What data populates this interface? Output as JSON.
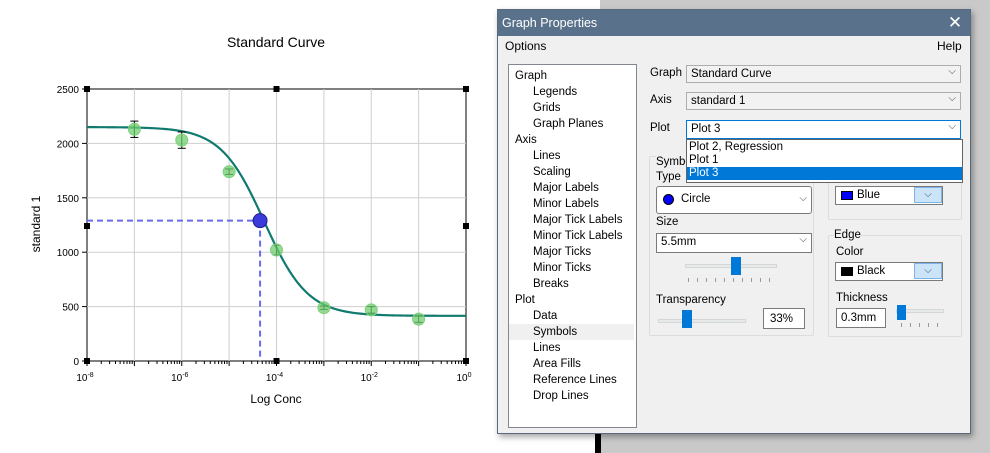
{
  "chart": {
    "title": "Standard Curve",
    "xlabel": "Log Conc",
    "ylabel": "standard 1"
  },
  "chart_data": {
    "type": "scatter",
    "title": "Standard Curve",
    "xlabel": "Log Conc",
    "ylabel": "standard 1",
    "x_scale": "log",
    "xlim": [
      1e-08,
      1
    ],
    "ylim": [
      0,
      2500
    ],
    "x_tick_labels": [
      {
        "base": "10",
        "exp": "-8"
      },
      {
        "base": "10",
        "exp": "-6"
      },
      {
        "base": "10",
        "exp": "-4"
      },
      {
        "base": "10",
        "exp": "-2"
      },
      {
        "base": "10",
        "exp": "0"
      }
    ],
    "y_tick_labels": [
      "0",
      "500",
      "1000",
      "1500",
      "2000",
      "2500"
    ],
    "grid": true,
    "series": [
      {
        "type": "scatter",
        "points": [
          {
            "x": 1e-07,
            "y": 2130,
            "err": 75
          },
          {
            "x": 1e-06,
            "y": 2030,
            "err": 75
          },
          {
            "x": 1e-05,
            "y": 1740,
            "err": 25
          },
          {
            "x": 0.0001,
            "y": 1020,
            "err": 45
          },
          {
            "x": 0.001,
            "y": 490,
            "err": 15
          },
          {
            "x": 0.01,
            "y": 470,
            "err": 30
          },
          {
            "x": 0.1,
            "y": 385,
            "err": 30
          }
        ],
        "color": "#6fcf6f"
      },
      {
        "type": "line",
        "fit": "4PL",
        "params": {
          "top": 2150,
          "bottom": 415,
          "ec50": 5.5e-05,
          "hill": 0.95
        },
        "color": "#117a6e"
      },
      {
        "type": "scatter",
        "points": [
          {
            "x": 4.5e-05,
            "y": 1290
          }
        ],
        "color": "#3b3bd9"
      }
    ],
    "drop_lines": {
      "x": 4.5e-05,
      "y": 1290,
      "color": "#6b6bee"
    }
  },
  "dialog": {
    "title": "Graph Properties",
    "close_glyph": "✕",
    "menu": {
      "options": "Options",
      "help": "Help"
    },
    "tree": [
      {
        "label": "Graph",
        "level": 0
      },
      {
        "label": "Legends",
        "level": 1
      },
      {
        "label": "Grids",
        "level": 1
      },
      {
        "label": "Graph Planes",
        "level": 1
      },
      {
        "label": "Axis",
        "level": 0
      },
      {
        "label": "Lines",
        "level": 1
      },
      {
        "label": "Scaling",
        "level": 1
      },
      {
        "label": "Major Labels",
        "level": 1
      },
      {
        "label": "Minor Labels",
        "level": 1
      },
      {
        "label": "Major Tick Labels",
        "level": 1
      },
      {
        "label": "Minor Tick Labels",
        "level": 1
      },
      {
        "label": "Major Ticks",
        "level": 1
      },
      {
        "label": "Minor Ticks",
        "level": 1
      },
      {
        "label": "Breaks",
        "level": 1
      },
      {
        "label": "Plot",
        "level": 0
      },
      {
        "label": "Data",
        "level": 1
      },
      {
        "label": "Symbols",
        "level": 1,
        "selected": true
      },
      {
        "label": "Lines",
        "level": 1
      },
      {
        "label": "Area Fills",
        "level": 1
      },
      {
        "label": "Reference Lines",
        "level": 1
      },
      {
        "label": "Drop Lines",
        "level": 1
      }
    ],
    "graph_label": "Graph",
    "graph_value": "Standard Curve",
    "axis_label": "Axis",
    "axis_value": "standard 1",
    "plot_label": "Plot",
    "plot_value": "Plot 3",
    "plot_options": [
      "Plot 2, Regression",
      "Plot 1",
      "Plot 3"
    ],
    "plot_selected_index": 2,
    "symbols_group": "Symbols",
    "type_label": "Type",
    "type_value": "Circle",
    "size_label": "Size",
    "size_value": "5.5mm",
    "transparency_label": "Transparency",
    "transparency_value": "33%",
    "transparency_fraction": 0.33,
    "size_slider_fraction": 0.55,
    "fill_color_name": "Blue",
    "fill_color_hex": "#0000ff",
    "edge_group": "Edge",
    "edge_color_label": "Color",
    "edge_color_name": "Black",
    "edge_color_hex": "#000000",
    "thickness_label": "Thickness",
    "thickness_value": "0.3mm",
    "thickness_slider_fraction": 0.1,
    "chevron": "⌵"
  },
  "colors": {
    "titlebar": "#59718b",
    "selection": "#0078d7",
    "fit_line": "#117a6e"
  }
}
